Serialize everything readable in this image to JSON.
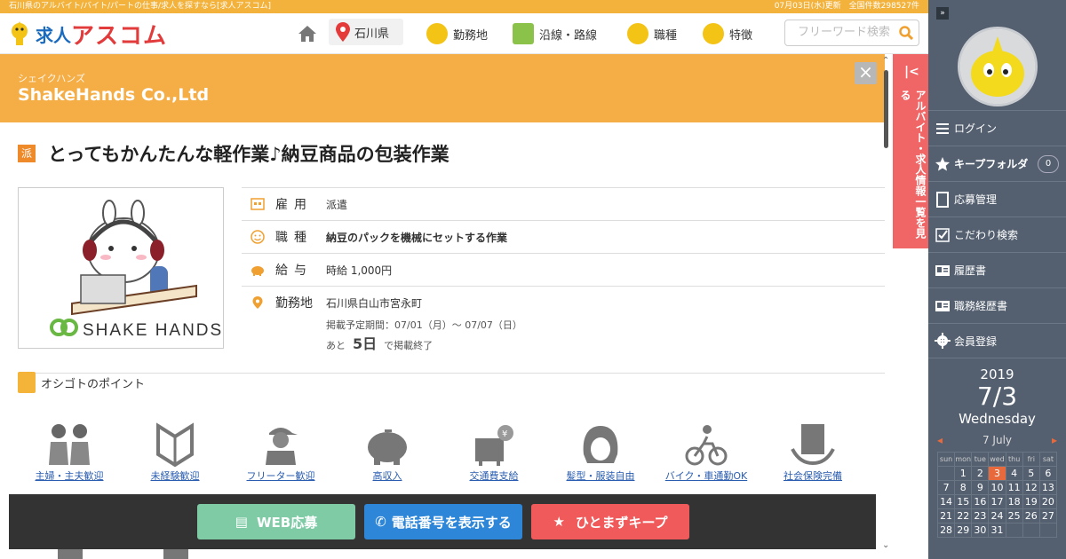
{
  "topbar": {
    "left_text": "石川県のアルバイト/バイト/パートの仕事/求人を探すなら[求人アスコム]",
    "right_text": "07月03日(水)更新　全国件数298527件"
  },
  "header": {
    "logo_kyujin": "求人",
    "logo_ascom": "アスコム",
    "location": "石川県",
    "nav": [
      "勤務地",
      "沿線・路線",
      "職種",
      "特徴"
    ],
    "search_placeholder": "フリーワード検索"
  },
  "banner": {
    "company_kana": "シェイクハンズ",
    "company_name": "ShakeHands Co.,Ltd",
    "close": "×"
  },
  "job": {
    "badge": "派",
    "title": "とってもかんたんな軽作業♪納豆商品の包装作業",
    "logo_text": "SHAKE HANDS",
    "rows": [
      {
        "label": "雇用",
        "value": "派遣"
      },
      {
        "label": "職種",
        "value": "納豆のパックを機械にセットする作業"
      },
      {
        "label": "給与",
        "value": "時給 1,000円"
      },
      {
        "label": "勤務地",
        "value": "石川県白山市宮永町"
      }
    ],
    "period": "掲載予定期間：07/01（月）～ 07/07（日）",
    "remain_prefix": "あと",
    "remain_days": "5日",
    "remain_suffix": "で掲載終了"
  },
  "points": {
    "heading": "オシゴトのポイント",
    "items": [
      {
        "label": "主婦・主夫歓迎",
        "icon": "couple-icon"
      },
      {
        "label": "未経験歓迎",
        "icon": "beginner-mark-icon"
      },
      {
        "label": "フリーター歓迎",
        "icon": "freeter-icon"
      },
      {
        "label": "高収入",
        "icon": "piggy-bank-icon"
      },
      {
        "label": "交通費支給",
        "icon": "transport-fee-icon"
      },
      {
        "label": "髪型・服装自由",
        "icon": "hairstyle-icon"
      },
      {
        "label": "バイク・車通勤OK",
        "icon": "bicycle-icon"
      },
      {
        "label": "社会保険完備",
        "icon": "insurance-icon"
      }
    ]
  },
  "actions": {
    "apply": "WEB応募",
    "phone": "電話番号を表示する",
    "keep": "ひとまずキープ",
    "apply_color": "#7ecba6",
    "phone_color": "#2d86d8",
    "keep_color": "#f05a5a"
  },
  "sidetab": {
    "text": "アルバイト・求人情報一覧を見る",
    "arrow": "|<"
  },
  "sidebar": {
    "menu": [
      {
        "label": "ログイン",
        "icon": "hamburger-icon"
      },
      {
        "label": "キープフォルダ",
        "icon": "star-icon",
        "count": "0"
      },
      {
        "label": "応募管理",
        "icon": "document-icon"
      },
      {
        "label": "こだわり検索",
        "icon": "checkbox-icon"
      },
      {
        "label": "履歴書",
        "icon": "resume-icon"
      },
      {
        "label": "職務経歴書",
        "icon": "career-icon"
      },
      {
        "label": "会員登録",
        "icon": "gear-icon"
      }
    ],
    "calendar": {
      "year": "2019",
      "date": "7/3",
      "weekday": "Wednesday",
      "month_label": "7 July",
      "headers": [
        "sun",
        "mon",
        "tue",
        "wed",
        "thu",
        "fri",
        "sat"
      ],
      "weeks": [
        [
          "",
          "1",
          "2",
          "3",
          "4",
          "5",
          "6"
        ],
        [
          "7",
          "8",
          "9",
          "10",
          "11",
          "12",
          "13"
        ],
        [
          "14",
          "15",
          "16",
          "17",
          "18",
          "19",
          "20"
        ],
        [
          "21",
          "22",
          "23",
          "24",
          "25",
          "26",
          "27"
        ],
        [
          "28",
          "29",
          "30",
          "31",
          "",
          "",
          ""
        ]
      ],
      "today": "3",
      "prev": "◂",
      "next": "▸"
    }
  }
}
